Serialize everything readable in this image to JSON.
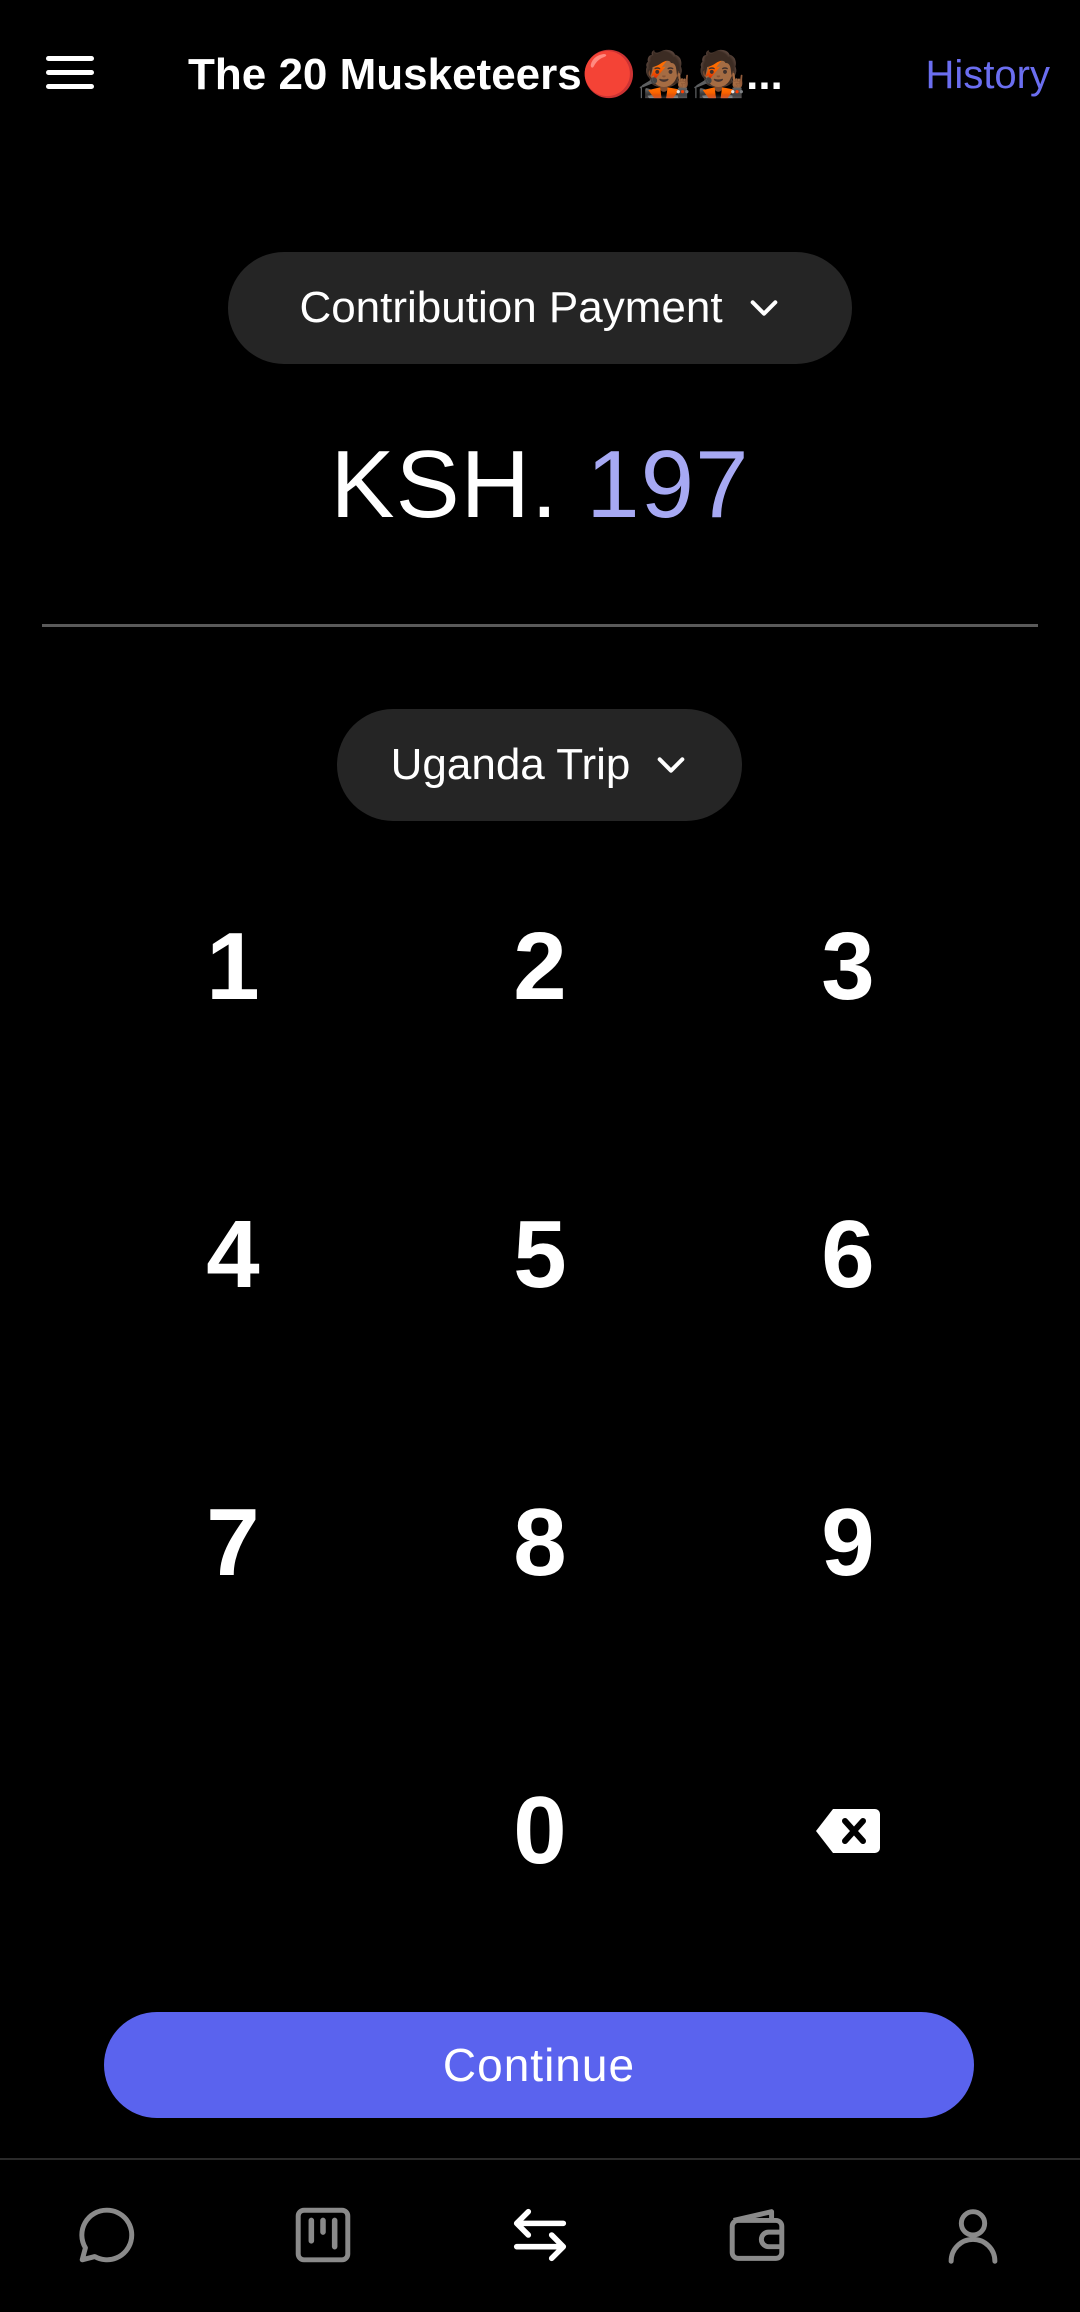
{
  "header": {
    "title": "The 20 Musketeers🔴🧑🏾‍🎤🧑🏾‍🎤...",
    "history_label": "History"
  },
  "payment_type": {
    "selected": "Contribution Payment"
  },
  "amount": {
    "currency": "KSH.",
    "value": "197"
  },
  "target": {
    "selected": "Uganda Trip"
  },
  "keypad": {
    "keys": [
      "1",
      "2",
      "3",
      "4",
      "5",
      "6",
      "7",
      "8",
      "9",
      "0"
    ]
  },
  "continue_label": "Continue",
  "nav": {
    "items": [
      "chat-icon",
      "board-icon",
      "transfer-icon",
      "wallet-icon",
      "profile-icon"
    ]
  },
  "colors": {
    "accent": "#5a63ee",
    "history_link": "#6b6ef0",
    "amount_value": "#a7a9f3",
    "pill_bg": "#252525",
    "background": "#000000"
  }
}
